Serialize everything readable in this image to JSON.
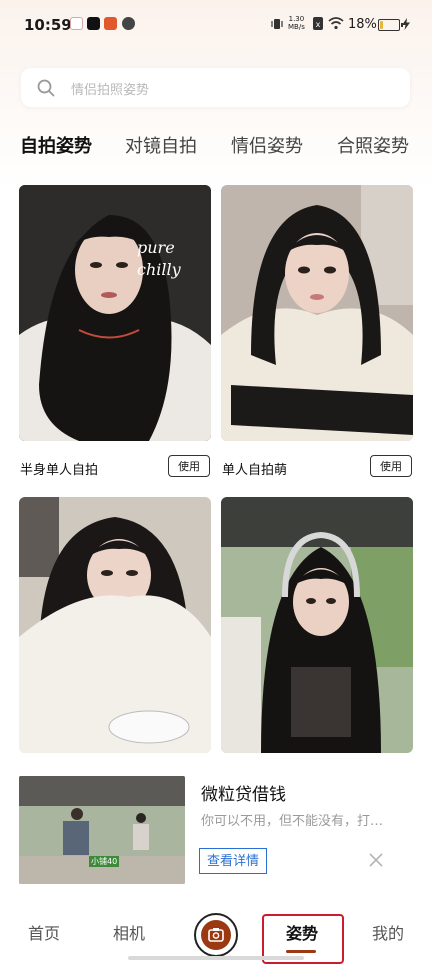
{
  "status_bar": {
    "time": "10:59",
    "net_speed_value": "1.30",
    "net_speed_unit": "MB/s",
    "battery": "18%",
    "battery_level": 0.18
  },
  "search": {
    "placeholder": "情侣拍照姿势"
  },
  "tabs": [
    {
      "label": "自拍姿势",
      "active": true
    },
    {
      "label": "对镜自拍",
      "active": false
    },
    {
      "label": "情侣姿势",
      "active": false
    },
    {
      "label": "合照姿势",
      "active": false
    }
  ],
  "cards": [
    {
      "title": "半身单人自拍",
      "button": "使用",
      "overlay_text": "pure chilly"
    },
    {
      "title": "单人自拍萌",
      "button": "使用"
    },
    {
      "title": "",
      "button": ""
    },
    {
      "title": "",
      "button": ""
    }
  ],
  "ad": {
    "title": "微粒贷借钱",
    "subtitle": "你可以不用，但不能没有，打…",
    "cta": "查看详情",
    "image_caption": "小铺40"
  },
  "nav": {
    "items": [
      {
        "label": "首页",
        "active": false
      },
      {
        "label": "相机",
        "active": false
      },
      {
        "label": "姿势",
        "active": true
      },
      {
        "label": "我的",
        "active": false
      }
    ]
  },
  "colors": {
    "accent": "#9b3a12",
    "link_blue": "#2a6fd6",
    "highlight_red": "#cc1c2b"
  }
}
